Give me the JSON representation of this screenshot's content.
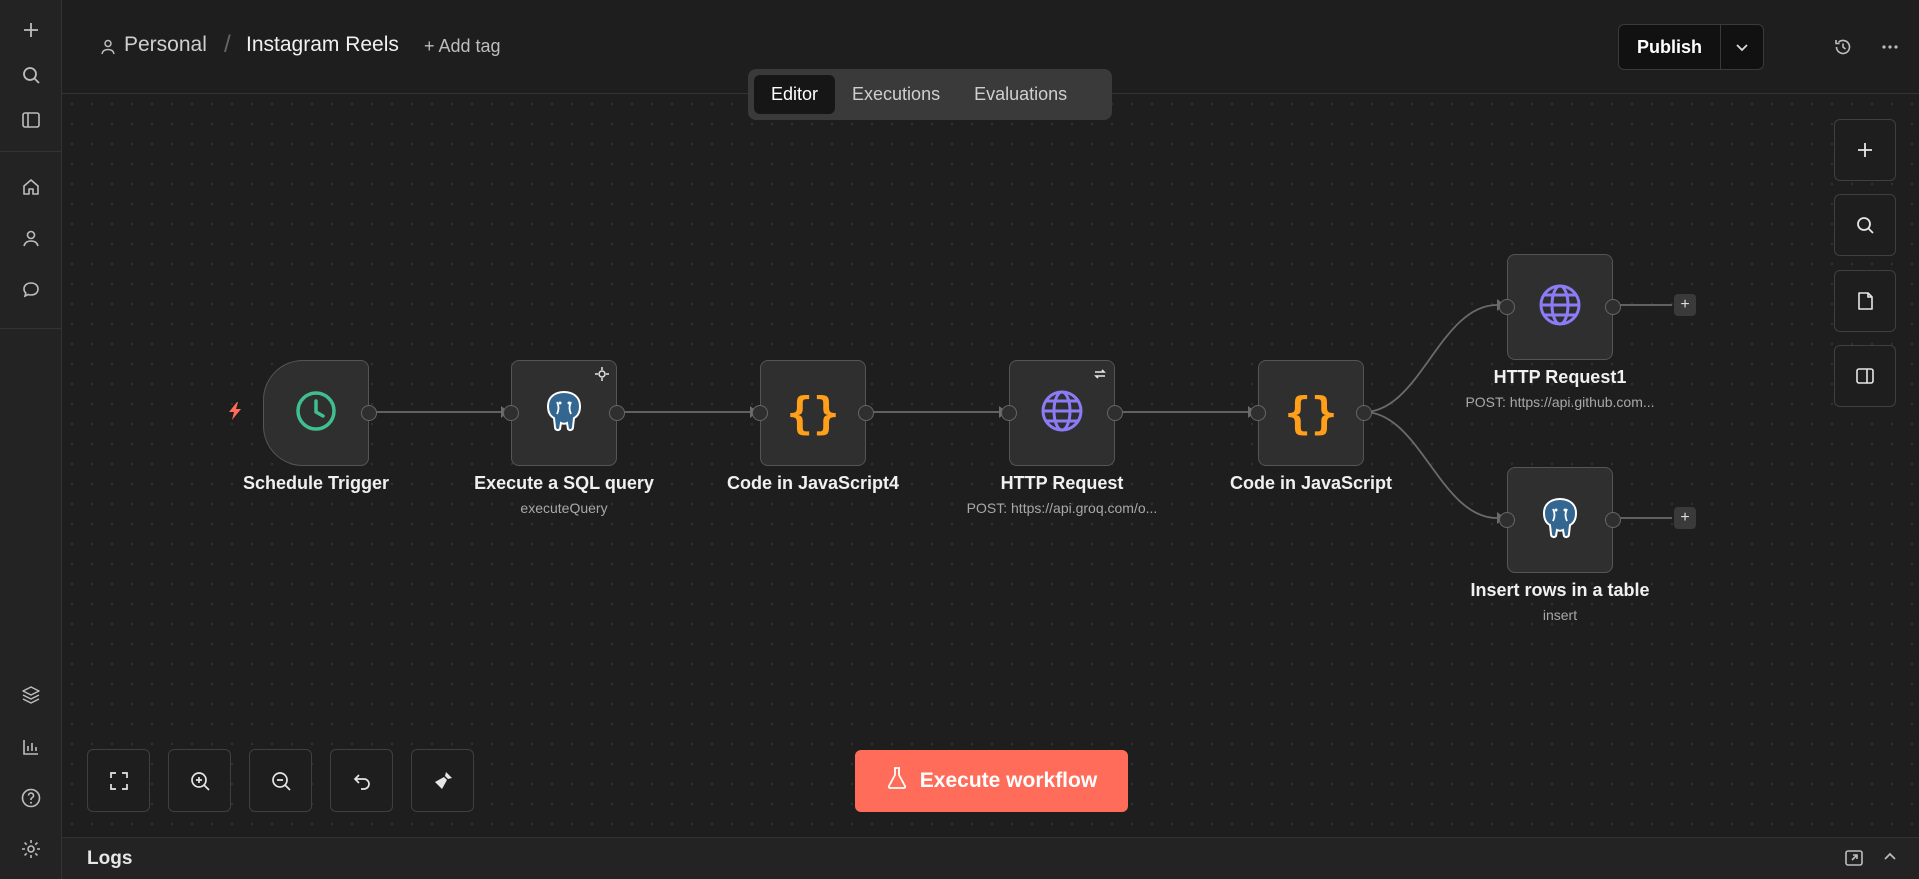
{
  "sidebar": {
    "top_icons": [
      "plus-icon",
      "search-icon",
      "panel-icon",
      "home-icon",
      "user-icon",
      "chat-icon"
    ],
    "bottom_icons": [
      "templates-icon",
      "insights-icon",
      "help-icon",
      "settings-icon"
    ]
  },
  "header": {
    "project": "Personal",
    "separator": "/",
    "workflow_name": "Instagram Reels",
    "add_tag": "+ Add tag",
    "tabs": [
      {
        "label": "Editor",
        "active": true
      },
      {
        "label": "Executions",
        "active": false
      },
      {
        "label": "Evaluations",
        "active": false
      }
    ],
    "publish_label": "Publish"
  },
  "nodes": [
    {
      "title": "Schedule Trigger",
      "subtitle": "",
      "icon": "clock-icon"
    },
    {
      "title": "Execute a SQL query",
      "subtitle": "executeQuery",
      "icon": "postgres-icon"
    },
    {
      "title": "Code in JavaScript4",
      "subtitle": "",
      "icon": "code-braces-icon"
    },
    {
      "title": "HTTP Request",
      "subtitle": "POST: https://api.groq.com/o...",
      "icon": "globe-icon"
    },
    {
      "title": "Code in JavaScript",
      "subtitle": "",
      "icon": "code-braces-icon"
    },
    {
      "title": "HTTP Request1",
      "subtitle": "POST: https://api.github.com...",
      "icon": "globe-icon"
    },
    {
      "title": "Insert rows in a table",
      "subtitle": "insert",
      "icon": "postgres-icon"
    }
  ],
  "canvas": {
    "execute_label": "Execute workflow",
    "code_glyph": "{}",
    "plus_glyph": "+"
  },
  "logs": {
    "title": "Logs"
  },
  "colors": {
    "accent": "#ff6d5a",
    "trigger_green": "#3fbf8f",
    "code_orange": "#ff9f1a",
    "globe_purple": "#8b7cf6"
  }
}
